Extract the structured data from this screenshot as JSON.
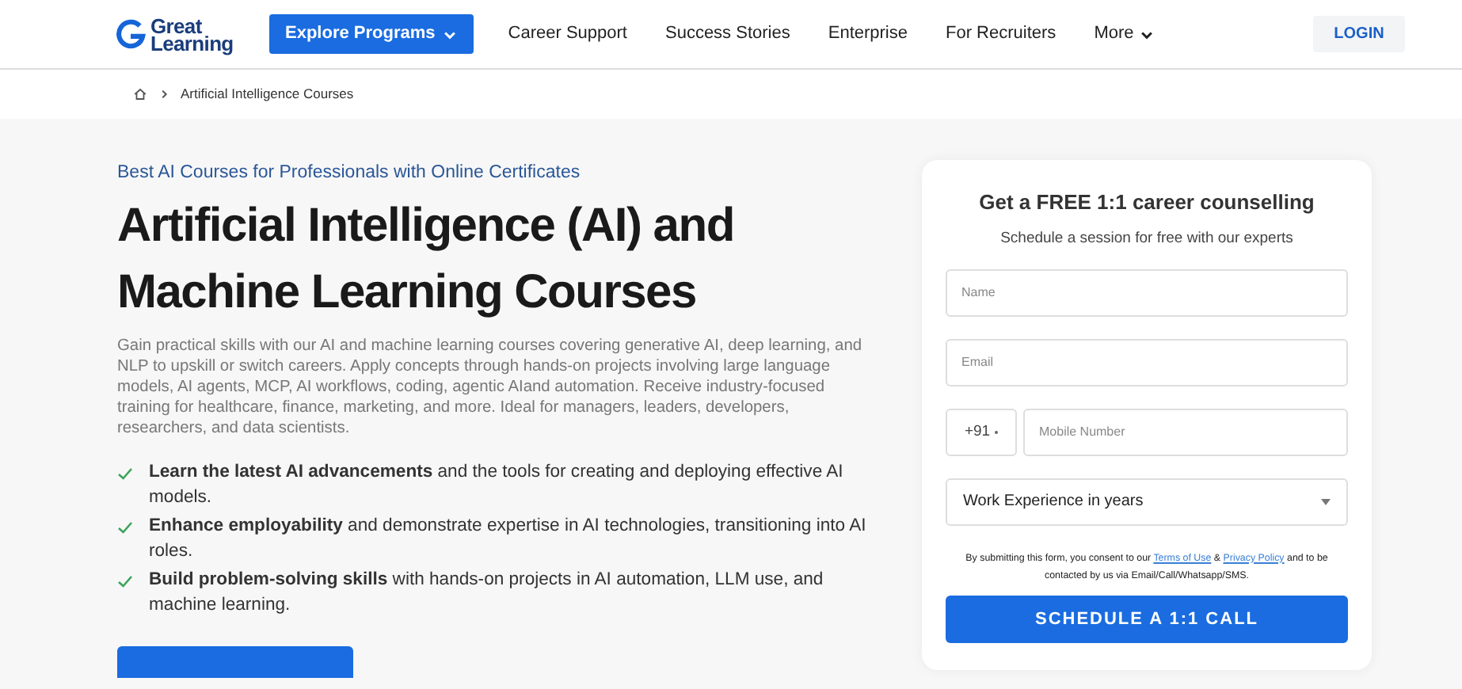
{
  "logo": {
    "lines": [
      "Great",
      "Learning"
    ]
  },
  "nav": {
    "primary": "Explore Programs",
    "links": [
      {
        "label": "Career Support",
        "has_menu": false
      },
      {
        "label": "Success Stories",
        "has_menu": false
      },
      {
        "label": "Enterprise",
        "has_menu": false
      },
      {
        "label": "For Recruiters",
        "has_menu": false
      },
      {
        "label": "More",
        "has_menu": true
      }
    ],
    "login": "LOGIN"
  },
  "breadcrumb": [
    "Artificial Intelligence Courses"
  ],
  "hero": {
    "eyebrow": "Best AI Courses for Professionals with Online Certificates",
    "title_lines": [
      "Artificial Intelligence (AI) and",
      "Machine Learning Courses"
    ],
    "description": "Gain practical skills with our AI and machine learning courses covering generative AI, deep learning, and NLP to upskill or switch careers. Apply concepts through hands-on projects involving large language models, AI agents, MCP, AI workflows, coding, agentic AIand automation. Receive industry-focused training for healthcare, finance, marketing, and more. Ideal for managers, leaders, developers, researchers, and data scientists.",
    "benefits": [
      "**Learn the latest AI advancements** and the tools for creating and deploying effective AI models.",
      "**Enhance employability** and demonstrate expertise in AI technologies, transitioning into AI roles.",
      "**Build problem-solving skills** with hands-on projects in AI automation, LLM use, and machine learning."
    ]
  },
  "form": {
    "title": "Get a FREE 1:1 career counselling",
    "subtitle": "Schedule a session for free with our experts",
    "fields": [
      {
        "kind": "text",
        "placeholder": "Name"
      },
      {
        "kind": "text",
        "placeholder": "Email"
      },
      {
        "kind": "phone",
        "code": "+91",
        "placeholder": "Mobile Number"
      },
      {
        "kind": "select",
        "value": "Work Experience in years"
      }
    ],
    "consent": {
      "before": "By submitting this form, you consent to our",
      "link1": "Terms of Use",
      "between": "&",
      "link2": "Privacy Policy",
      "after": "and to be contacted by us via Email/Call/Whatsapp/SMS."
    },
    "submit": "SCHEDULE A 1:1 CALL"
  }
}
